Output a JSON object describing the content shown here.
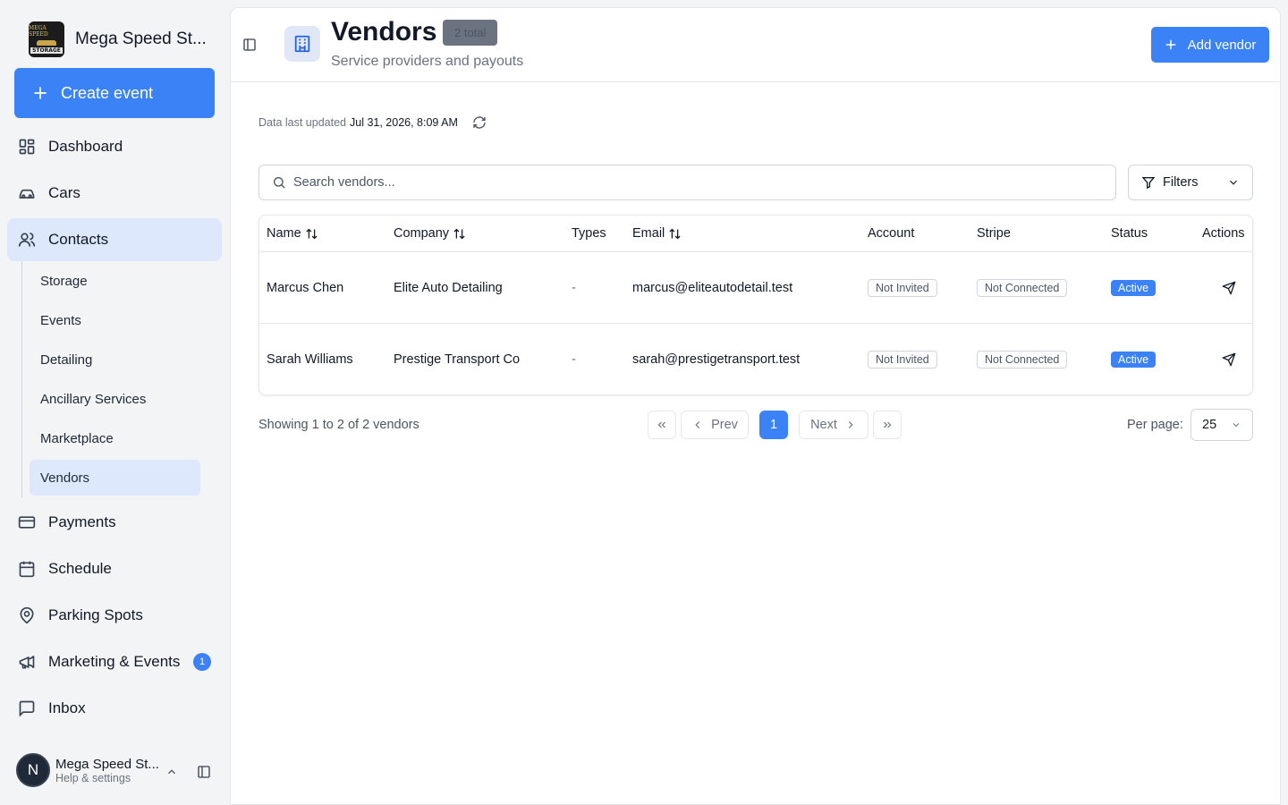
{
  "sidebar": {
    "brand_name": "Mega Speed St...",
    "logo_text_top": "MEGA SPEED",
    "logo_text_bottom": "STORAGE",
    "create_label": "Create event",
    "nav": {
      "dashboard": "Dashboard",
      "cars": "Cars",
      "contacts": "Contacts",
      "payments": "Payments",
      "schedule": "Schedule",
      "parking": "Parking Spots",
      "marketing": "Marketing & Events",
      "marketing_badge": "1",
      "inbox": "Inbox"
    },
    "contacts_sub": {
      "storage": "Storage",
      "events": "Events",
      "detailing": "Detailing",
      "ancillary": "Ancillary Services",
      "marketplace": "Marketplace",
      "vendors": "Vendors"
    },
    "user": {
      "initial": "N",
      "name": "Mega Speed St...",
      "sub": "Help & settings"
    }
  },
  "header": {
    "title": "Vendors",
    "total_badge": "2 total",
    "subtitle": "Service providers and payouts",
    "add_label": "Add vendor"
  },
  "toolbar": {
    "updated_label": "Data last updated",
    "updated_value": "Jul 31, 2026, 8:09 AM",
    "search_placeholder": "Search vendors...",
    "filters_label": "Filters"
  },
  "table": {
    "columns": {
      "name": "Name",
      "company": "Company",
      "types": "Types",
      "email": "Email",
      "account": "Account",
      "stripe": "Stripe",
      "status": "Status",
      "actions": "Actions"
    },
    "rows": [
      {
        "name": "Marcus Chen",
        "company": "Elite Auto Detailing",
        "types": "-",
        "email": "marcus@eliteautodetail.test",
        "account": "Not Invited",
        "stripe": "Not Connected",
        "status": "Active"
      },
      {
        "name": "Sarah Williams",
        "company": "Prestige Transport Co",
        "types": "-",
        "email": "sarah@prestigetransport.test",
        "account": "Not Invited",
        "stripe": "Not Connected",
        "status": "Active"
      }
    ]
  },
  "pagination": {
    "showing": "Showing 1 to 2 of 2 vendors",
    "prev": "Prev",
    "current": "1",
    "next": "Next",
    "per_page_label": "Per page:",
    "per_page_value": "25"
  },
  "colors": {
    "accent": "#3b82f6",
    "active_nav": "#dde8fd"
  }
}
